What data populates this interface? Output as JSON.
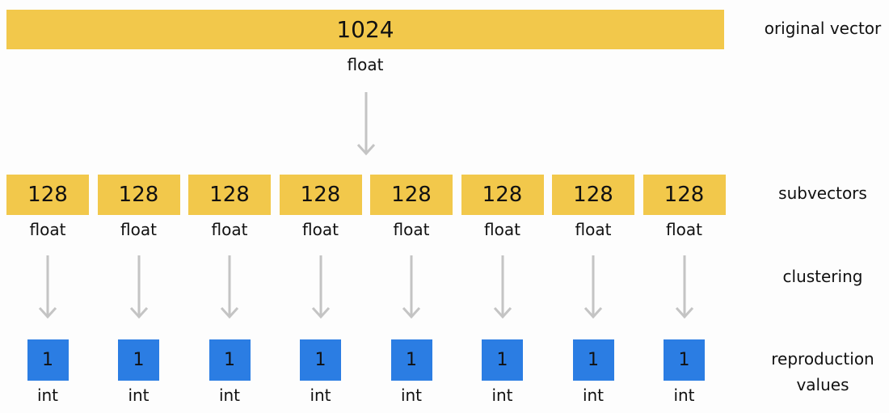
{
  "original": {
    "size": "1024",
    "type": "float",
    "color": "#f2c84b"
  },
  "subvectors": [
    {
      "size": "128",
      "type": "float"
    },
    {
      "size": "128",
      "type": "float"
    },
    {
      "size": "128",
      "type": "float"
    },
    {
      "size": "128",
      "type": "float"
    },
    {
      "size": "128",
      "type": "float"
    },
    {
      "size": "128",
      "type": "float"
    },
    {
      "size": "128",
      "type": "float"
    },
    {
      "size": "128",
      "type": "float"
    }
  ],
  "codes": [
    {
      "value": "1",
      "type": "int"
    },
    {
      "value": "1",
      "type": "int"
    },
    {
      "value": "1",
      "type": "int"
    },
    {
      "value": "1",
      "type": "int"
    },
    {
      "value": "1",
      "type": "int"
    },
    {
      "value": "1",
      "type": "int"
    },
    {
      "value": "1",
      "type": "int"
    },
    {
      "value": "1",
      "type": "int"
    }
  ],
  "labels": {
    "original": "original vector",
    "subvectors": "subvectors",
    "clustering": "clustering",
    "reproduction_line1": "reproduction",
    "reproduction_line2": "values"
  },
  "colors": {
    "subvector": "#f2c84b",
    "code": "#2b7de3",
    "arrow": "#c4c4c4"
  }
}
